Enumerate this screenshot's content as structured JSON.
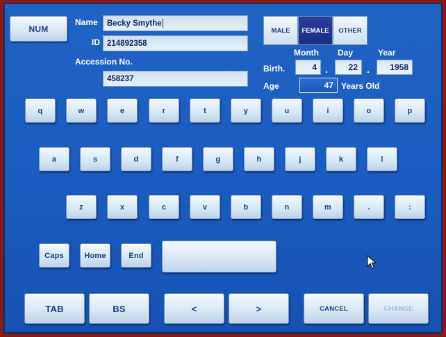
{
  "left_buttons": {
    "num": "NUM"
  },
  "patient": {
    "name_label": "Name",
    "name_value": "Becky Smythe",
    "id_label": "ID",
    "id_value": "214892358",
    "accession_label": "Accession No.",
    "accession_value": "458237"
  },
  "gender": {
    "options": [
      "MALE",
      "FEMALE",
      "OTHER"
    ],
    "selected": "FEMALE"
  },
  "birth": {
    "label": "Birth.",
    "month_label": "Month",
    "day_label": "Day",
    "year_label": "Year",
    "month": "4",
    "day": "22",
    "year": "1958",
    "separator": "."
  },
  "age": {
    "label": "Age",
    "value": "47",
    "suffix": "Years Old"
  },
  "keyboard": {
    "row1": [
      "q",
      "w",
      "e",
      "r",
      "t",
      "y",
      "u",
      "i",
      "o",
      "p"
    ],
    "row2": [
      "a",
      "s",
      "d",
      "f",
      "g",
      "h",
      "j",
      "k",
      "l"
    ],
    "row3": [
      "z",
      "x",
      "c",
      "v",
      "b",
      "n",
      "m",
      ".",
      ":"
    ],
    "caps": "Caps",
    "home": "Home",
    "end": "End",
    "space": ""
  },
  "bottom_bar": {
    "tab": "TAB",
    "bs": "BS",
    "left": "<",
    "right": ">",
    "cancel": "CANCEL",
    "change": "CHANGE"
  },
  "colors": {
    "screen_background": "#1a5cbf",
    "bezel": "#8a1a12",
    "selected_gender": "#1d2d86",
    "key_text": "#1d3f85"
  }
}
